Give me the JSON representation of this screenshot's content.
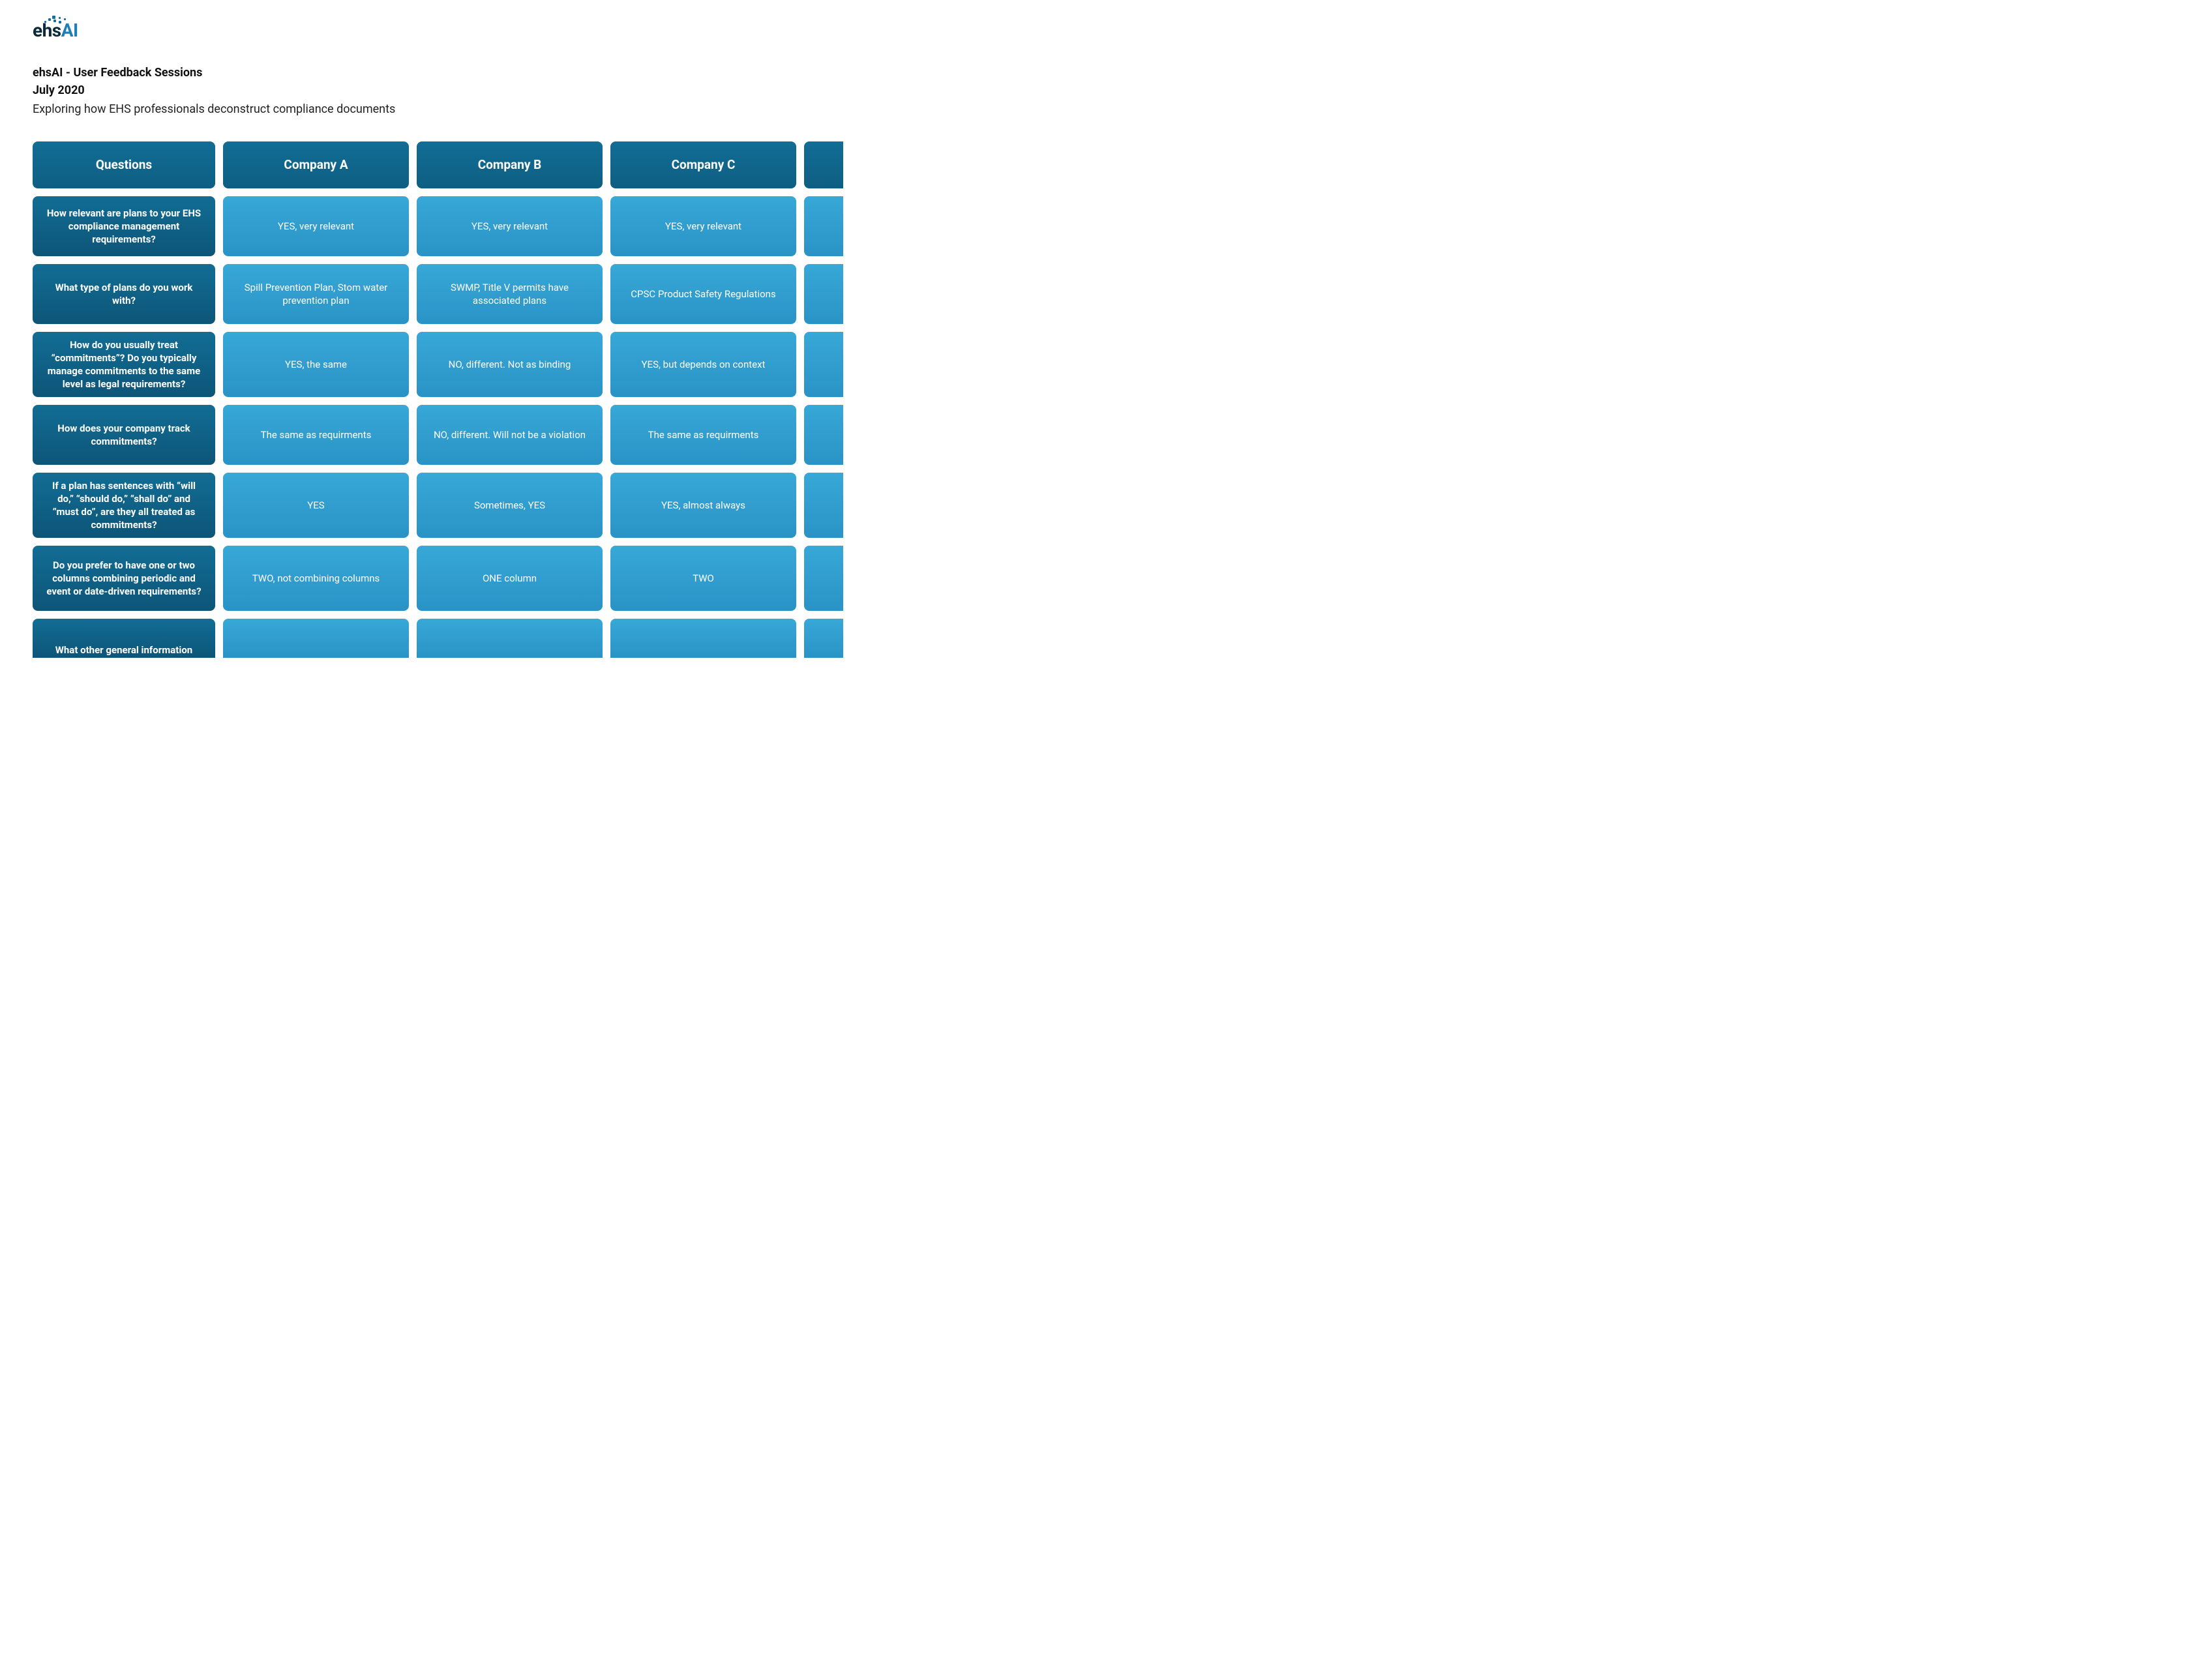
{
  "logo": {
    "ehs": "ehs",
    "ai": "AI"
  },
  "header": {
    "title": "ehsAI - User Feedback Sessions",
    "date": "July 2020",
    "subtitle": "Exploring how EHS professionals deconstruct compliance documents"
  },
  "columns": {
    "q": "Questions",
    "a": "Company A",
    "b": "Company B",
    "c": "Company C"
  },
  "rows": [
    {
      "q": "How relevant are plans to your EHS compliance management requirements?",
      "a": "YES, very relevant",
      "b": "YES, very relevant",
      "c": "YES, very relevant"
    },
    {
      "q": "What type of plans do you work with?",
      "a": "Spill Prevention Plan, Stom water prevention plan",
      "b": "SWMP, Title V permits have associated plans",
      "c": "CPSC Product Safety Regulations"
    },
    {
      "q": "How do you usually treat “commitments”? Do you typically manage commitments to the same level as legal requirements?",
      "a": "YES, the same",
      "b": "NO, different. Not as binding",
      "c": "YES, but depends on context"
    },
    {
      "q": "How does your company track commitments?",
      "a": "The same as requirments",
      "b": "NO, different. Will not be a violation",
      "c": "The same as requirments"
    },
    {
      "q": "If a plan has sentences with “will do,” “should do,” “shall do” and “must do”, are they all treated as commitments?",
      "a": "YES",
      "b": "Sometimes, YES",
      "c": "YES, almost always"
    },
    {
      "q": "Do you prefer to have one or two columns combining periodic and event or date-driven requirements?",
      "a": "TWO, not combining columns",
      "b": "ONE column",
      "c": "TWO"
    },
    {
      "q": "What other general information",
      "a": "",
      "b": "",
      "c": ""
    }
  ]
}
